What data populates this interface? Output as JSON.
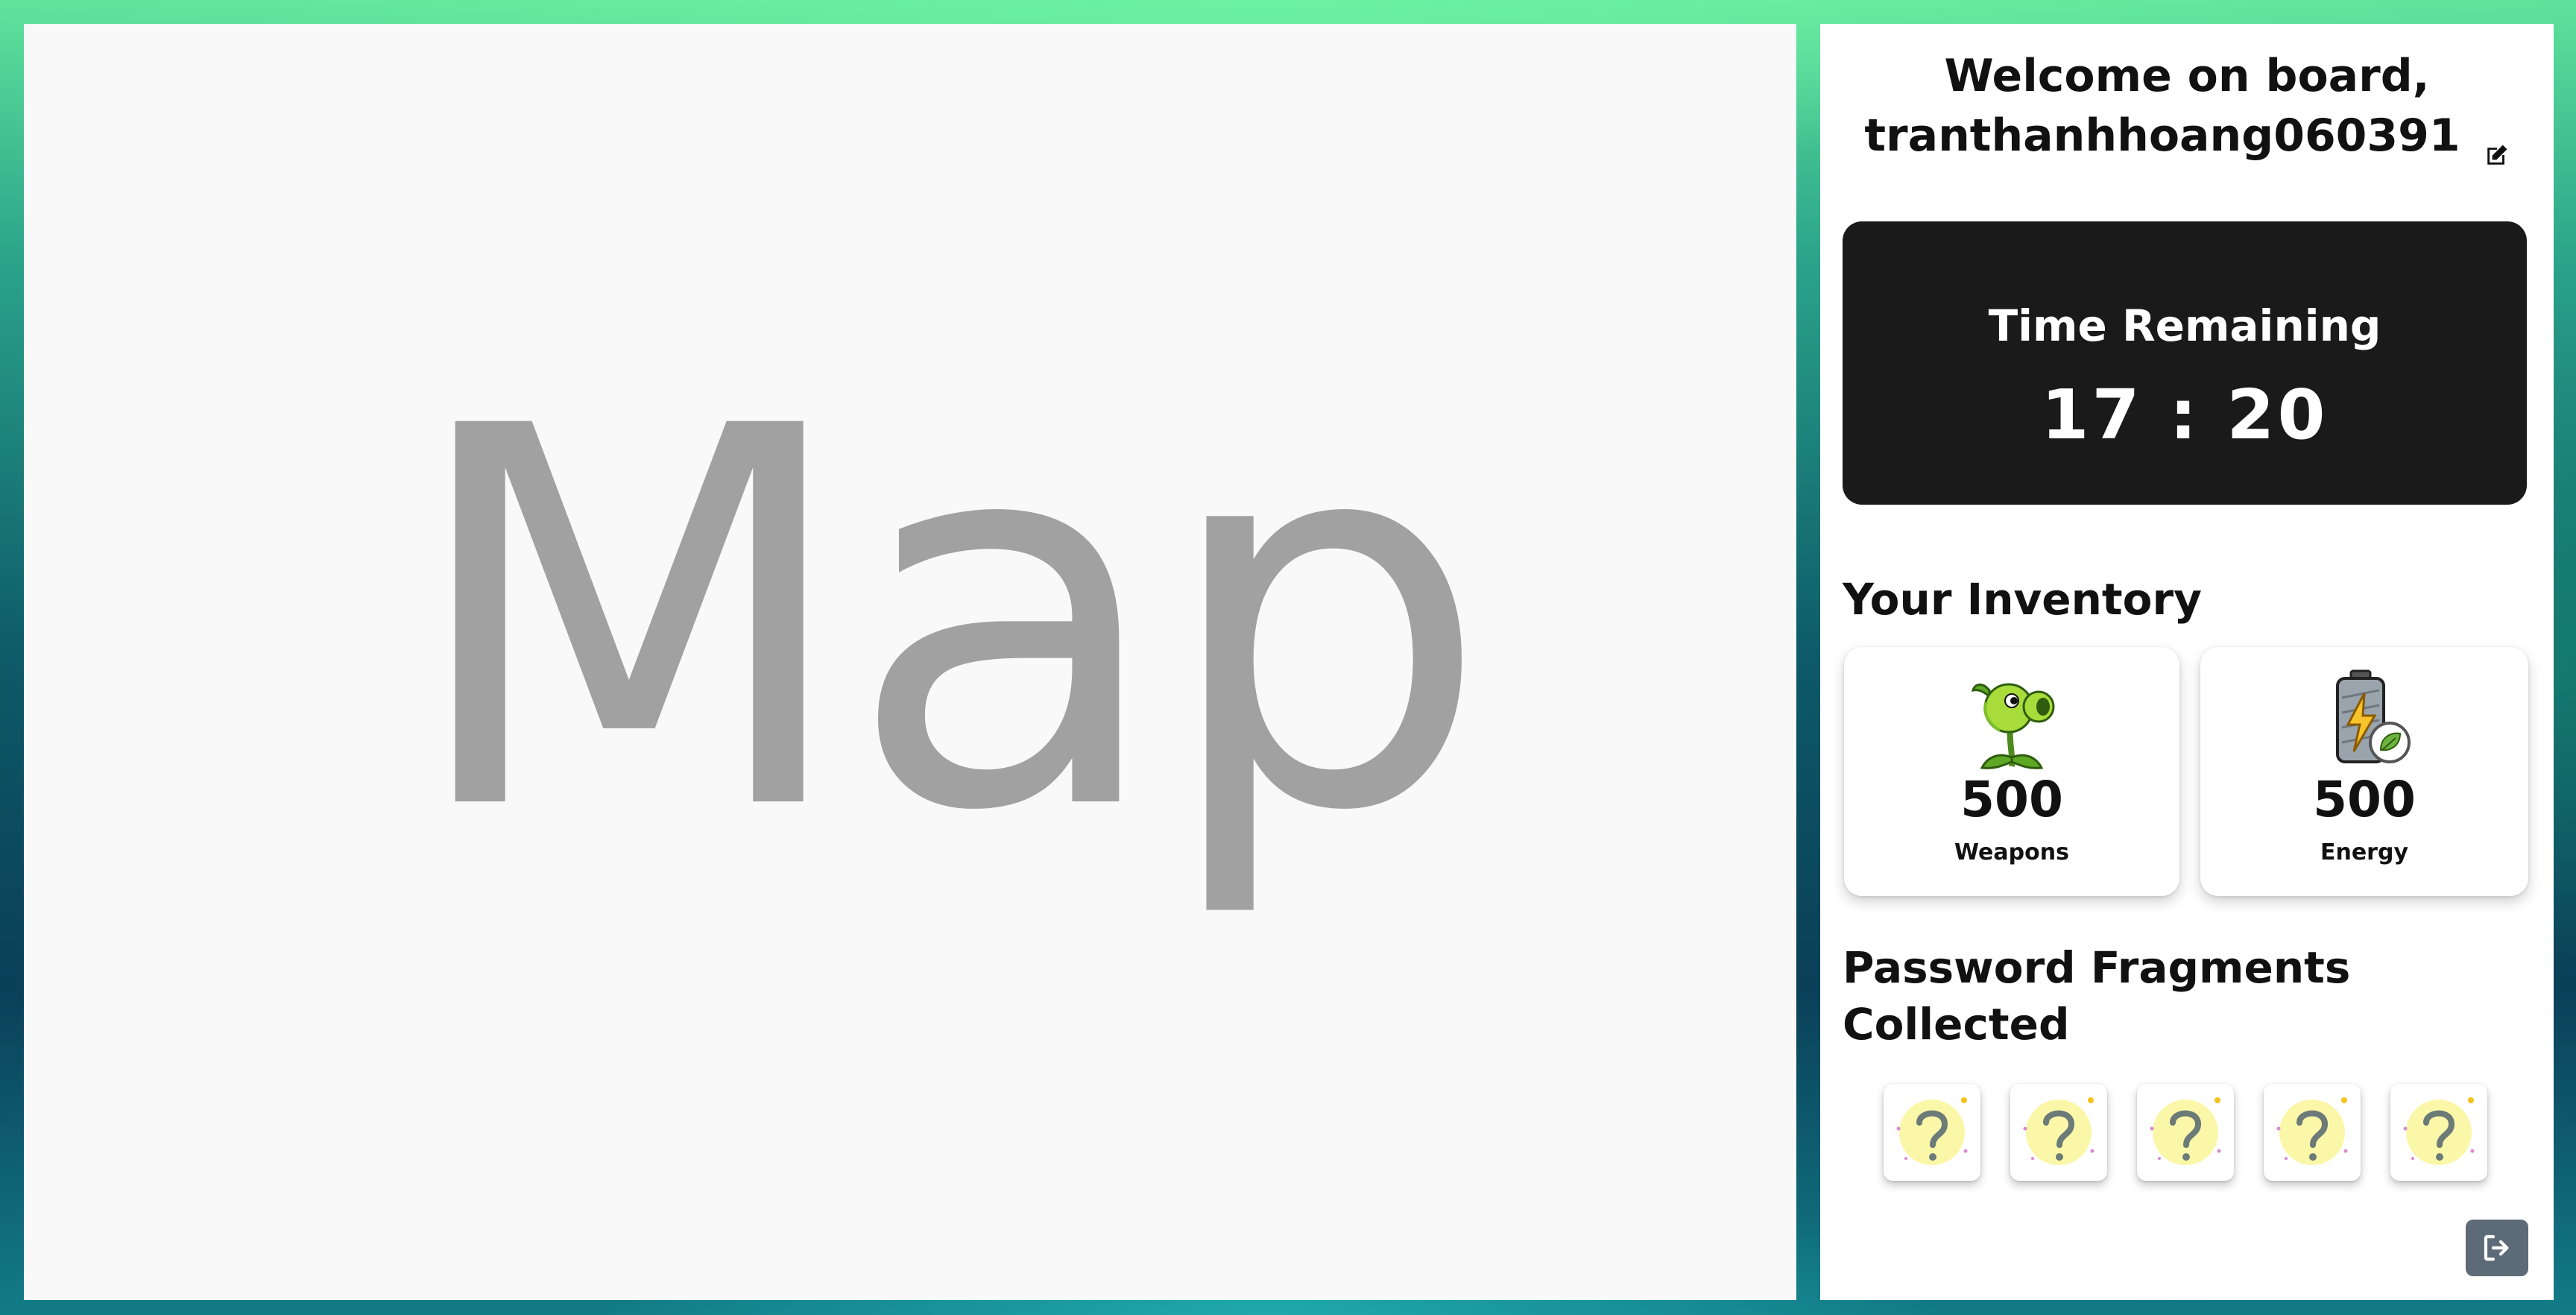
{
  "map": {
    "label": "Map"
  },
  "sidebar": {
    "welcome_line1": "Welcome on board,",
    "username": "tranthanhhoang060391",
    "edit_icon": "edit-icon",
    "timer": {
      "title": "Time Remaining",
      "value": "17 : 20"
    },
    "inventory": {
      "heading": "Your Inventory",
      "items": [
        {
          "icon": "peashooter-icon",
          "count": "500",
          "label": "Weapons"
        },
        {
          "icon": "battery-leaf-icon",
          "count": "500",
          "label": "Energy"
        }
      ]
    },
    "fragments": {
      "heading": "Password Fragments Collected",
      "items": [
        {
          "icon": "question-mark-icon",
          "collected": false
        },
        {
          "icon": "question-mark-icon",
          "collected": false
        },
        {
          "icon": "question-mark-icon",
          "collected": false
        },
        {
          "icon": "question-mark-icon",
          "collected": false
        },
        {
          "icon": "question-mark-icon",
          "collected": false
        }
      ]
    },
    "logout_icon": "logout-icon"
  },
  "colors": {
    "timer_background": "#1a1a1a",
    "map_background": "#f9f9f9",
    "map_text": "#a1a1a1",
    "logout_button": "#5d6b78",
    "fragment_glow": "#fbf7a8"
  }
}
